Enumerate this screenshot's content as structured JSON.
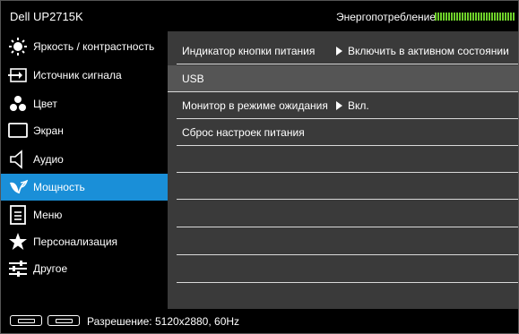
{
  "header": {
    "model": "Dell UP2715K",
    "energy_label": "Энергопотребление"
  },
  "colors": {
    "accent": "#1a8fd8",
    "energy_bar": "#6ed12a",
    "content_bg": "#3a3a3a",
    "selected_row": "#555555"
  },
  "sidebar": {
    "items": [
      {
        "label": "Яркость / контрастность",
        "icon": "brightness-icon"
      },
      {
        "label": "Источник сигнала",
        "icon": "input-source-icon"
      },
      {
        "label": "Цвет",
        "icon": "color-icon"
      },
      {
        "label": "Экран",
        "icon": "display-icon"
      },
      {
        "label": "Аудио",
        "icon": "audio-icon"
      },
      {
        "label": "Мощность",
        "icon": "power-leaf-icon",
        "active": true
      },
      {
        "label": "Меню",
        "icon": "menu-icon"
      },
      {
        "label": "Персонализация",
        "icon": "star-icon"
      },
      {
        "label": "Другое",
        "icon": "sliders-icon"
      }
    ]
  },
  "content": {
    "rows": [
      {
        "name": "Индикатор кнопки питания",
        "value": "Включить в активном состоянии"
      },
      {
        "name": "USB",
        "value": ""
      },
      {
        "name": "Монитор в режиме ожидания",
        "value": "Вкл."
      },
      {
        "name": "Сброс настроек питания",
        "value": ""
      }
    ]
  },
  "footer": {
    "resolution": "Разрешение: 5120x2880, 60Hz"
  }
}
